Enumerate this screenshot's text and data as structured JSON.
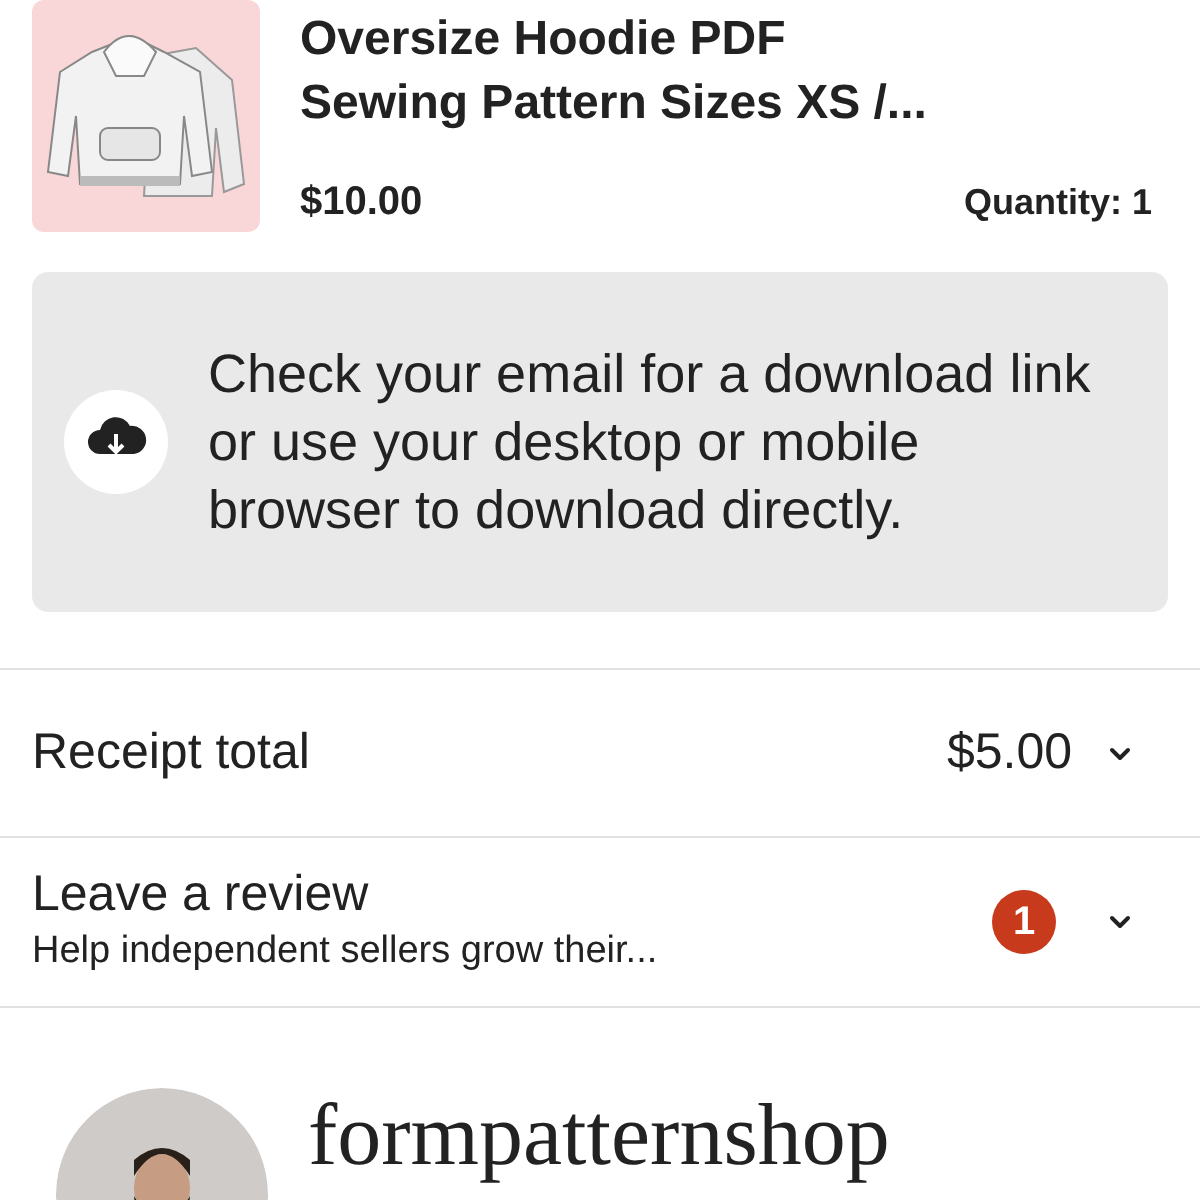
{
  "item": {
    "title": "Oversize Hoodie PDF Sewing Pattern Sizes XS /...",
    "price": "$10.00",
    "quantity": "Quantity: 1"
  },
  "download_notice": {
    "text": "Check your email for a download link or use your desktop or mobile browser to download directly."
  },
  "receipt": {
    "label": "Receipt total",
    "amount": "$5.00",
    "expanded": false
  },
  "review": {
    "title": "Leave a review",
    "subtitle": "Help independent sellers grow their...",
    "badge": "1",
    "expanded": false
  },
  "shop": {
    "name": "formpatternshop"
  }
}
